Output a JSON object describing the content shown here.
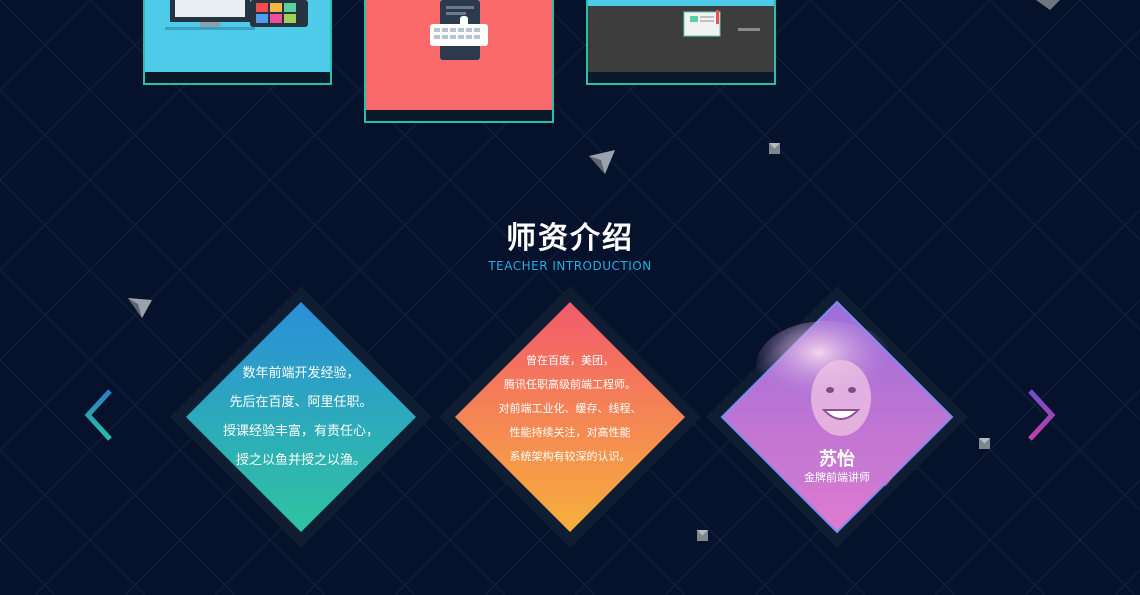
{
  "section": {
    "title": "师资介绍",
    "subtitle": "TEACHER INTRODUCTION"
  },
  "teachers": [
    {
      "lines": [
        "数年前端开发经验，",
        "先后在百度、阿里任职。",
        "授课经验丰富，有责任心，",
        "授之以鱼并授之以渔。"
      ]
    },
    {
      "lines": [
        "曾在百度，美团，",
        "腾讯任职高级前端工程师。",
        "对前端工业化、缓存、线程、",
        "性能持续关注，对高性能",
        "系统架构有较深的认识。"
      ]
    },
    {
      "name": "苏怡",
      "role": "金牌前端讲师"
    }
  ],
  "colors": {
    "background": "#06112b",
    "card_border": "#2bbfa9",
    "accent_blue": "#1fb0e6"
  },
  "icons": {
    "prev": "chevron-left-icon",
    "next": "chevron-right-icon"
  }
}
